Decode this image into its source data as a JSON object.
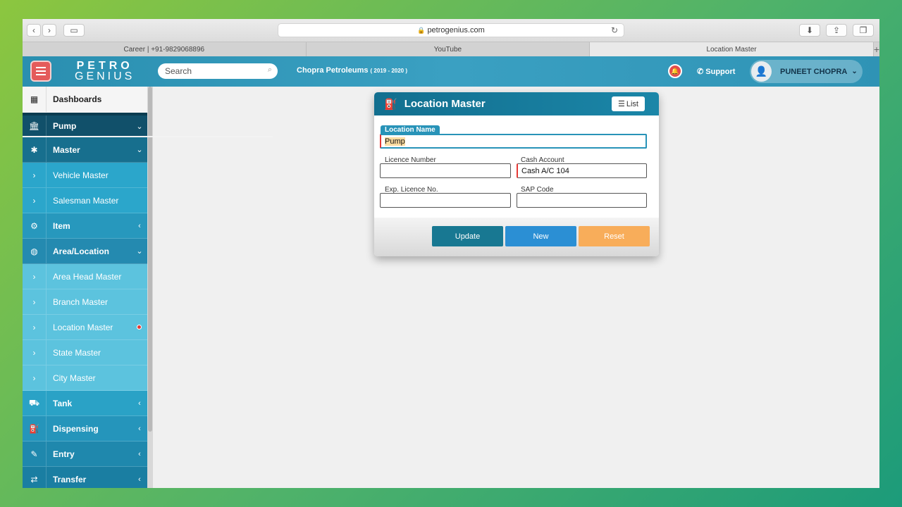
{
  "browser": {
    "url": "petrogenius.com",
    "tabs": [
      "Career | +91-9829068896",
      "YouTube",
      "Location Master"
    ]
  },
  "header": {
    "logo_line1": "PETRO",
    "logo_line2": "GENIUS",
    "search_placeholder": "Search",
    "company": "Chopra Petroleums",
    "fiscal_year": "( 2019 - 2020 )",
    "support_label": "Support",
    "user_name": "PUNEET CHOPRA"
  },
  "sidebar": {
    "items": [
      {
        "label": "Dashboards",
        "icon": "grid-icon"
      },
      {
        "label": "Pump",
        "icon": "bank-icon"
      },
      {
        "label": "Master",
        "icon": "asterisk-icon"
      },
      {
        "label": "Vehicle Master",
        "icon": "chevron-right-icon"
      },
      {
        "label": "Salesman Master",
        "icon": "chevron-right-icon"
      },
      {
        "label": "Item",
        "icon": "cubes-icon"
      },
      {
        "label": "Area/Location",
        "icon": "globe-icon"
      },
      {
        "label": "Area Head Master",
        "icon": "chevron-right-icon"
      },
      {
        "label": "Branch Master",
        "icon": "chevron-right-icon"
      },
      {
        "label": "Location Master",
        "icon": "chevron-right-icon"
      },
      {
        "label": "State Master",
        "icon": "chevron-right-icon"
      },
      {
        "label": "City Master",
        "icon": "chevron-right-icon"
      },
      {
        "label": "Tank",
        "icon": "truck-icon"
      },
      {
        "label": "Dispensing",
        "icon": "fuel-pump-icon"
      },
      {
        "label": "Entry",
        "icon": "edit-icon"
      },
      {
        "label": "Transfer",
        "icon": "exchange-icon"
      }
    ]
  },
  "form": {
    "title": "Location Master",
    "list_label": "List",
    "location_name_label": "Location Name",
    "location_name_value": "Pump",
    "licence_number_label": "Licence Number",
    "licence_number_value": "",
    "cash_account_label": "Cash Account",
    "cash_account_value": "Cash A/C 104",
    "exp_licence_label": "Exp. Licence No.",
    "exp_licence_value": "",
    "sap_code_label": "SAP Code",
    "sap_code_value": "",
    "update_label": "Update",
    "new_label": "New",
    "reset_label": "Reset"
  },
  "colors": {
    "header_blue": "#2a8fb0",
    "update": "#187892",
    "new": "#2b8fd4",
    "reset": "#f8ad5a",
    "accent_red": "#e53935"
  }
}
